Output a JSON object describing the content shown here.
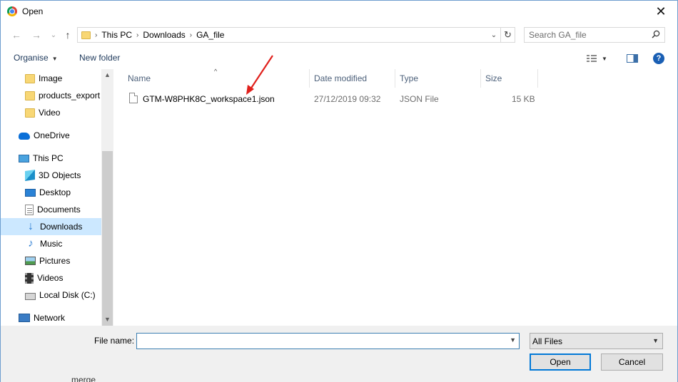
{
  "window": {
    "title": "Open",
    "close_glyph": "✕",
    "app_icon": "chrome-icon"
  },
  "nav": {
    "back_glyph": "←",
    "forward_glyph": "→",
    "recent_glyph": "⌄",
    "up_glyph": "↑",
    "breadcrumb": [
      "This PC",
      "Downloads",
      "GA_file"
    ],
    "search_placeholder": "Search GA_file"
  },
  "command_bar": {
    "organise": "Organise",
    "new_folder": "New folder"
  },
  "sidebar": {
    "items": [
      {
        "label": "Image",
        "icon": "folder-icon"
      },
      {
        "label": "products_export",
        "icon": "folder-icon"
      },
      {
        "label": "Video",
        "icon": "folder-icon"
      },
      {
        "label": "OneDrive",
        "icon": "onedrive-icon"
      },
      {
        "label": "This PC",
        "icon": "this-pc-icon"
      },
      {
        "label": "3D Objects",
        "icon": "3d-objects-icon"
      },
      {
        "label": "Desktop",
        "icon": "desktop-icon"
      },
      {
        "label": "Documents",
        "icon": "documents-icon"
      },
      {
        "label": "Downloads",
        "icon": "downloads-icon",
        "selected": true
      },
      {
        "label": "Music",
        "icon": "music-icon"
      },
      {
        "label": "Pictures",
        "icon": "pictures-icon"
      },
      {
        "label": "Videos",
        "icon": "videos-icon"
      },
      {
        "label": "Local Disk (C:)",
        "icon": "local-disk-icon"
      },
      {
        "label": "Network",
        "icon": "network-icon"
      }
    ]
  },
  "file_list": {
    "columns": [
      "Name",
      "Date modified",
      "Type",
      "Size"
    ],
    "rows": [
      {
        "name": "GTM-W8PHK8C_workspace1.json",
        "date": "27/12/2019 09:32",
        "type": "JSON File",
        "size": "15 KB"
      }
    ]
  },
  "footer": {
    "file_name_label": "File name:",
    "file_name_value": "",
    "file_type": "All Files",
    "open_label": "Open",
    "cancel_label": "Cancel"
  },
  "background": {
    "partial_text": "merge"
  },
  "colors": {
    "selection": "#cce8ff",
    "accent": "#0078d7",
    "annotation_arrow": "#e0201c"
  }
}
